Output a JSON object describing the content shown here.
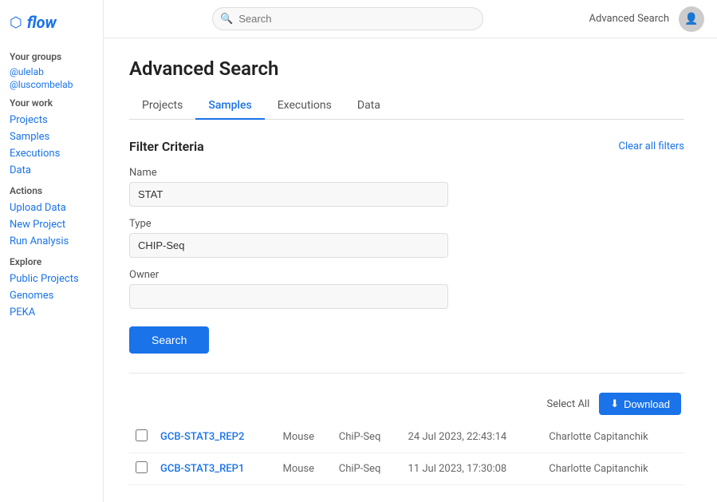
{
  "sidebar": {
    "logo_text": "flow",
    "logo_icon": "⬡",
    "groups_label": "Your groups",
    "groups": [
      "@ulelab",
      "@luscombelab"
    ],
    "work_label": "Your work",
    "work_items": [
      "Projects",
      "Samples",
      "Executions",
      "Data"
    ],
    "actions_label": "Actions",
    "actions_items": [
      "Upload Data",
      "New Project",
      "Run Analysis"
    ],
    "explore_label": "Explore",
    "explore_items": [
      "Public Projects",
      "Genomes",
      "PEKA"
    ]
  },
  "topbar": {
    "search_placeholder": "Search",
    "adv_search_label": "Advanced Search"
  },
  "page": {
    "title": "Advanced Search",
    "tabs": [
      "Projects",
      "Samples",
      "Executions",
      "Data"
    ],
    "active_tab": "Samples"
  },
  "filter": {
    "title": "Filter Criteria",
    "clear_label": "Clear all filters",
    "name_label": "Name",
    "name_value": "STAT",
    "type_label": "Type",
    "type_value": "CHIP-Seq",
    "owner_label": "Owner",
    "owner_value": "",
    "owner_placeholder": "",
    "search_btn_label": "Search"
  },
  "results": {
    "select_all_label": "Select All",
    "download_btn_label": "Download",
    "rows": [
      {
        "name": "GCB-STAT3_REP2",
        "organism": "Mouse",
        "type": "ChiP-Seq",
        "date": "24 Jul 2023, 22:43:14",
        "owner": "Charlotte Capitanchik"
      },
      {
        "name": "GCB-STAT3_REP1",
        "organism": "Mouse",
        "type": "ChiP-Seq",
        "date": "11 Jul 2023, 17:30:08",
        "owner": "Charlotte Capitanchik"
      }
    ]
  }
}
